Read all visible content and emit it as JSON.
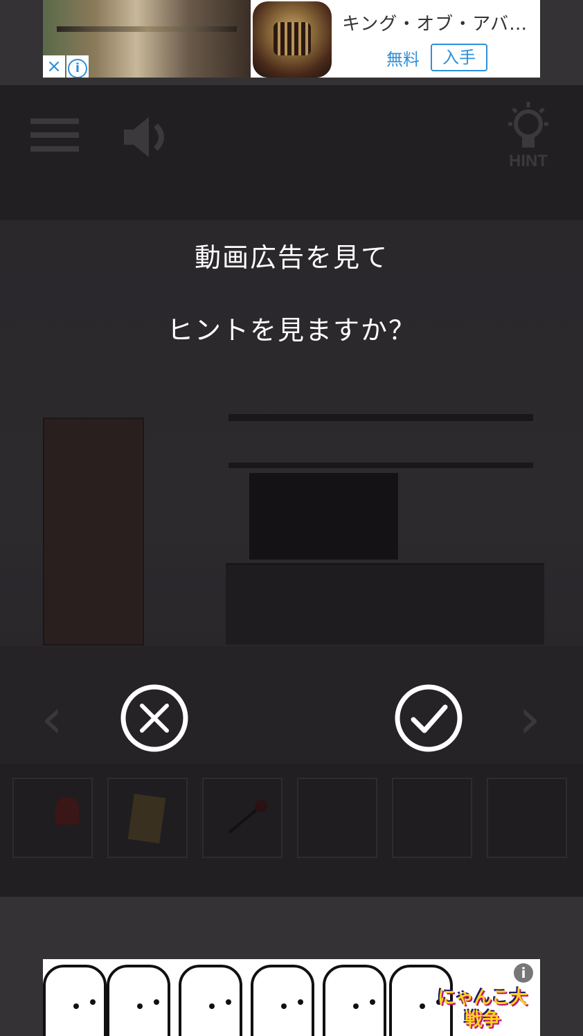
{
  "top_ad": {
    "title": "キング・オブ・アバ…",
    "free_label": "無料",
    "get_label": "入手",
    "close_icon": "×",
    "info_icon": "i"
  },
  "toolbar": {
    "hint_label": "HINT"
  },
  "dialog": {
    "line1": "動画広告を見て",
    "line2": "ヒントを見ますか？"
  },
  "navigation": {
    "left_arrow": "‹",
    "right_arrow": "›"
  },
  "bottom_ad": {
    "info_icon": "i",
    "game_logo": "にゃんこ大戦争"
  },
  "colors": {
    "overlay_bg": "#211f22",
    "dialog_text": "#ffffff",
    "ad_accent": "#2f8fd8"
  }
}
